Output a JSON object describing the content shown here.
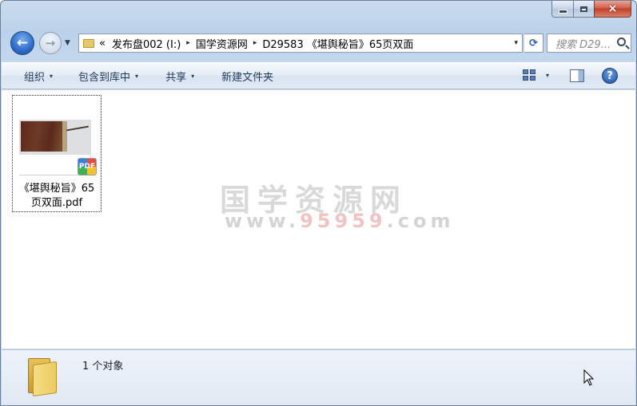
{
  "window": {
    "caption": {
      "minimize": "minimize",
      "maximize": "maximize",
      "close": "×"
    }
  },
  "nav": {
    "back_glyph": "←",
    "forward_glyph": "→",
    "history_glyph": "▼",
    "breadcrumb_overflow": "«",
    "breadcrumbs": [
      "发布盘002 (I:)",
      "国学资源网",
      "D29583 《堪舆秘旨》65页双面"
    ],
    "separator": "▸",
    "dropdown_glyph": "▾",
    "refresh_glyph": "⟳",
    "search_placeholder": "搜索 D29..."
  },
  "toolbar": {
    "organize": "组织",
    "include_in_library": "包含到库中",
    "share": "共享",
    "new_folder": "新建文件夹",
    "menu_arrow": "▾",
    "help": "?"
  },
  "files": [
    {
      "name_line1": "《堪舆秘旨》65",
      "name_line2": "页双面.pdf",
      "type": "PDF"
    }
  ],
  "watermark": {
    "cn": "国学资源网",
    "url_prefix": "www.",
    "url_accent": "95959",
    "url_suffix": ".com"
  },
  "details": {
    "count": "1 个对象"
  }
}
